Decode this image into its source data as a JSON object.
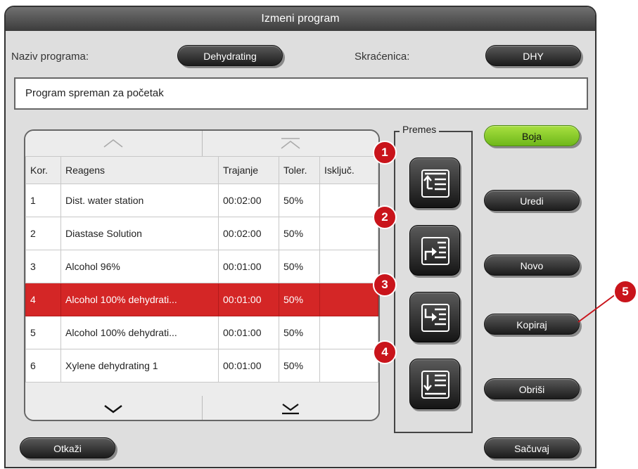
{
  "window": {
    "title": "Izmeni program"
  },
  "fields": {
    "name_label": "Naziv programa:",
    "name_value": "Dehydrating",
    "abbr_label": "Skraćenica:",
    "abbr_value": "DHY"
  },
  "status": "Program spreman za početak",
  "table": {
    "headers": [
      "Kor.",
      "Reagens",
      "Trajanje",
      "Toler.",
      "Isključ."
    ],
    "rows": [
      {
        "step": "1",
        "reagent": "Dist. water station",
        "duration": "00:02:00",
        "tol": "50%",
        "excl": ""
      },
      {
        "step": "2",
        "reagent": "Diastase Solution",
        "duration": "00:02:00",
        "tol": "50%",
        "excl": ""
      },
      {
        "step": "3",
        "reagent": "Alcohol 96%",
        "duration": "00:01:00",
        "tol": "50%",
        "excl": ""
      },
      {
        "step": "4",
        "reagent": "Alcohol 100% dehydrati...",
        "duration": "00:01:00",
        "tol": "50%",
        "excl": ""
      },
      {
        "step": "5",
        "reagent": "Alcohol 100% dehydrati...",
        "duration": "00:01:00",
        "tol": "50%",
        "excl": ""
      },
      {
        "step": "6",
        "reagent": "Xylene dehydrating 1",
        "duration": "00:01:00",
        "tol": "50%",
        "excl": ""
      }
    ],
    "selected_step": "4"
  },
  "move_group": {
    "label": "Premes",
    "badges": [
      "1",
      "2",
      "3",
      "4"
    ]
  },
  "buttons": {
    "color": "Boja",
    "edit": "Uredi",
    "new": "Novo",
    "copy": "Kopiraj",
    "delete": "Obriši",
    "cancel": "Otkaži",
    "save": "Sačuvaj"
  },
  "callout": "5",
  "colors": {
    "selected_row": "#d42626",
    "color_button": "#8fd12e",
    "badge": "#c9141b"
  }
}
